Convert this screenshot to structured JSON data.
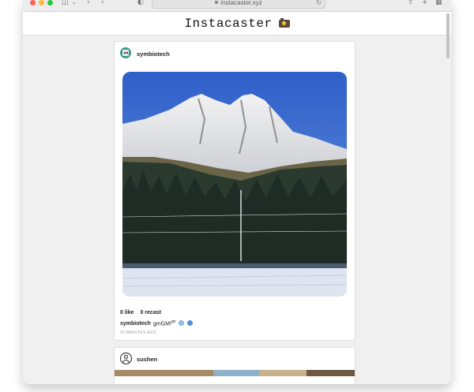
{
  "browser": {
    "url": "instacaster.xyz"
  },
  "site": {
    "title": "Instacaster"
  },
  "posts": [
    {
      "username": "symbiotech",
      "likes": "0 like",
      "recasts": "0 recast",
      "caption_user": "symbiotech",
      "caption_text": "gmGM!",
      "caption_sup": "gn",
      "timestamp": "20 MINUTES AGO"
    },
    {
      "username": "sushen"
    }
  ],
  "icons": {
    "traffic_lights": [
      "close-icon",
      "minimize-icon",
      "zoom-icon"
    ],
    "toolbar": [
      "sidebar-icon",
      "back-icon",
      "forward-icon",
      "shield-icon",
      "reload-icon",
      "share-icon",
      "new-tab-icon",
      "tab-overview-icon"
    ],
    "header": "camera-icon"
  },
  "colors": {
    "close": "#fe5f57",
    "minimize": "#febc2e",
    "zoom": "#28c840",
    "sky": "#3d6fd0",
    "emoji_planet": "#9ec3ea",
    "emoji_mask": "#4a90d9"
  }
}
